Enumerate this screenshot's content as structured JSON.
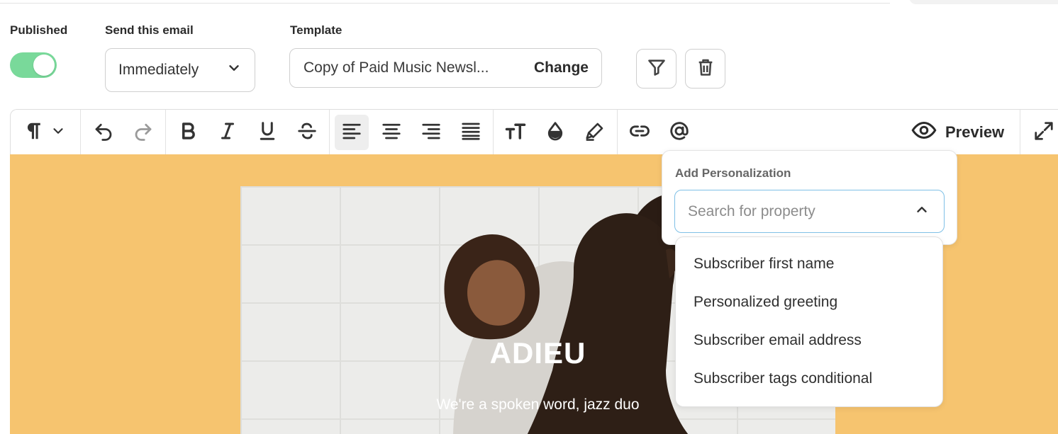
{
  "settings": {
    "published_label": "Published",
    "published_on": true,
    "send_label": "Send this email",
    "send_value": "Immediately",
    "template_label": "Template",
    "template_name": "Copy of Paid Music Newsl...",
    "template_change": "Change"
  },
  "action_icons": [
    "filter-icon",
    "trash-icon"
  ],
  "toolbar": {
    "icons": [
      "paragraph-icon",
      "chevron-down-icon",
      "undo-icon",
      "redo-icon",
      "bold-icon",
      "italic-icon",
      "underline-icon",
      "strikethrough-icon",
      "align-left-icon",
      "align-center-icon",
      "align-right-icon",
      "align-justify-icon",
      "text-size-icon",
      "text-color-icon",
      "highlight-icon",
      "link-icon",
      "mention-icon",
      "eye-icon",
      "expand-icon"
    ],
    "active": "align-left",
    "preview_label": "Preview"
  },
  "email_preview": {
    "background_color": "#f6c46f",
    "title": "ADIEU",
    "subtitle": "We're a spoken word, jazz duo"
  },
  "personalization": {
    "title": "Add Personalization",
    "search_placeholder": "Search for property",
    "options": [
      "Subscriber first name",
      "Personalized greeting",
      "Subscriber email address",
      "Subscriber tags conditional"
    ]
  },
  "colors": {
    "toggle_on": "#79d99a",
    "focus_border": "#7fc0e6"
  }
}
